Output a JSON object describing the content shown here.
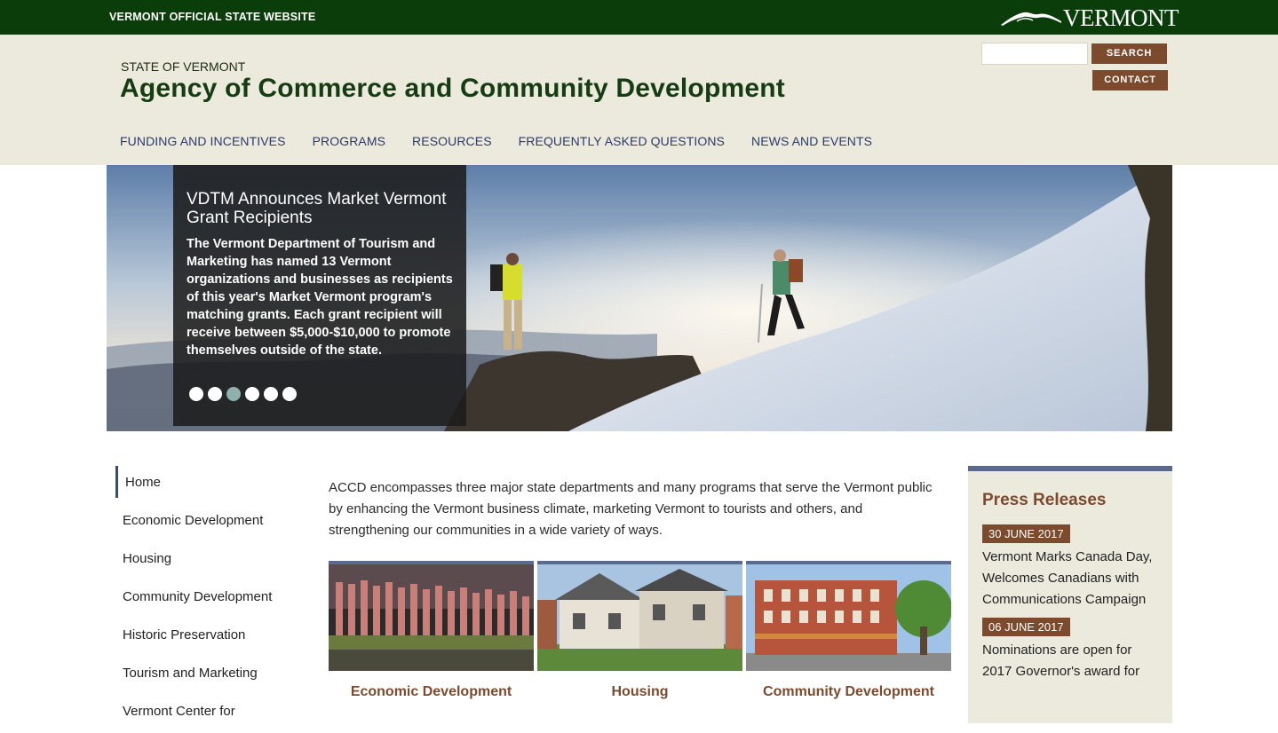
{
  "topbar": {
    "official_label": "VERMONT OFFICIAL STATE WEBSITE",
    "logo_text": "VERMONT"
  },
  "header": {
    "state_label": "STATE OF VERMONT",
    "agency_title": "Agency of Commerce and Community Development",
    "search_placeholder": "",
    "search_button": "SEARCH",
    "contact_button": "CONTACT"
  },
  "nav": {
    "items": [
      {
        "label": "FUNDING AND INCENTIVES"
      },
      {
        "label": "PROGRAMS"
      },
      {
        "label": "RESOURCES"
      },
      {
        "label": "FREQUENTLY ASKED QUESTIONS"
      },
      {
        "label": "NEWS AND EVENTS"
      }
    ]
  },
  "hero": {
    "title": "VDTM Announces Market Vermont Grant Recipients",
    "body": "The Vermont Department of Tourism and Marketing has named 13 Vermont organizations and businesses as recipients of this year's Market Vermont program's matching grants. Each grant recipient will receive between $5,000-$10,000 to promote themselves outside of the state.",
    "slide_count": 6,
    "active_slide": 3
  },
  "sidebar": {
    "items": [
      {
        "label": "Home"
      },
      {
        "label": "Economic Development"
      },
      {
        "label": "Housing"
      },
      {
        "label": "Community Development"
      },
      {
        "label": "Historic Preservation"
      },
      {
        "label": "Tourism and Marketing"
      },
      {
        "label": "Vermont Center for"
      }
    ]
  },
  "main": {
    "intro": "ACCD encompasses three major state departments and many programs that serve the Vermont public by enhancing the Vermont business climate, marketing Vermont to tourists and others, and strengthening our communities in a wide variety of ways.",
    "tiles": [
      {
        "label": "Economic Development"
      },
      {
        "label": "Housing"
      },
      {
        "label": "Community Development"
      }
    ]
  },
  "press": {
    "heading": "Press Releases",
    "items": [
      {
        "date": "30 JUNE 2017",
        "title": "Vermont Marks Canada Day, Welcomes Canadians with Communications Campaign"
      },
      {
        "date": "06 JUNE 2017",
        "title": "Nominations are open for 2017 Governor's award for"
      }
    ]
  },
  "colors": {
    "topbar": "#0b3d0b",
    "header_bg": "#ece9dd",
    "accent_brown": "#7c4a2d",
    "nav_blue": "#2a3a6a",
    "tile_border": "#5b6a8c"
  }
}
